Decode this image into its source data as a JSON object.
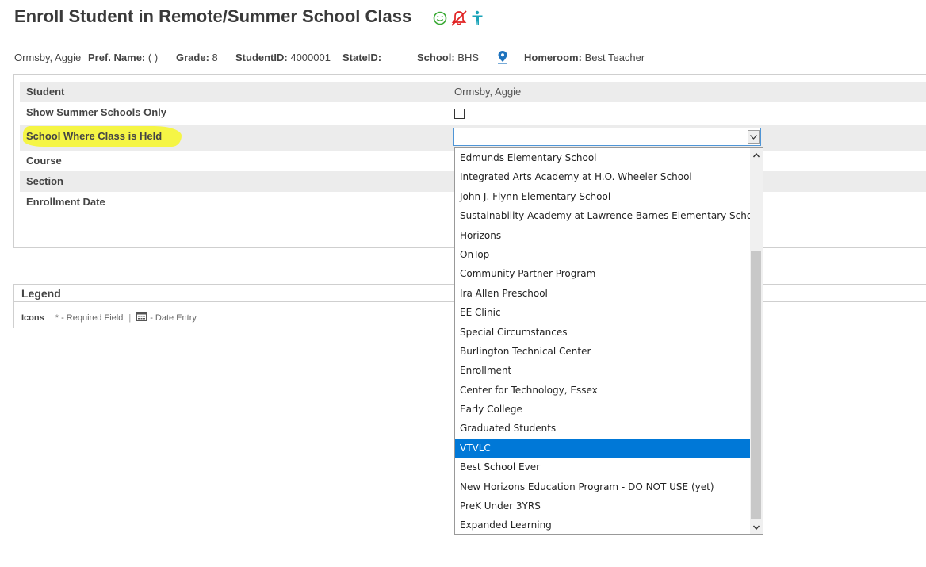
{
  "page": {
    "title": "Enroll Student in Remote/Summer School Class",
    "icons": [
      "smiley-icon",
      "alert-bell-off-icon",
      "accessibility-icon"
    ]
  },
  "student_bar": {
    "name": "Ormsby, Aggie",
    "pref_name_label": "Pref. Name:",
    "pref_name_value": "( )",
    "grade_label": "Grade:",
    "grade_value": "8",
    "student_id_label": "StudentID:",
    "student_id_value": "4000001",
    "state_id_label": "StateID:",
    "state_id_value": "",
    "school_label": "School:",
    "school_value": "BHS",
    "homeroom_label": "Homeroom:",
    "homeroom_value": "Best Teacher"
  },
  "form": {
    "student_label": "Student",
    "student_value": "Ormsby, Aggie",
    "summer_only_label": "Show Summer Schools Only",
    "summer_only_checked": false,
    "school_label": "School Where Class is Held",
    "school_value": "",
    "course_label": "Course",
    "section_label": "Section",
    "enrollment_date_label": "Enrollment Date"
  },
  "dropdown": {
    "options": [
      "Edmunds Elementary School",
      "Integrated Arts Academy at H.O. Wheeler School",
      "John J. Flynn Elementary School",
      "Sustainability Academy at Lawrence Barnes Elementary School",
      "Horizons",
      "OnTop",
      "Community Partner Program",
      "Ira Allen Preschool",
      "EE Clinic",
      "Special Circumstances",
      "Burlington Technical Center",
      "Enrollment",
      "Center for Technology, Essex",
      "Early College",
      "Graduated Students",
      "VTVLC",
      "Best School Ever",
      "New Horizons Education Program - DO NOT USE (yet)",
      "PreK Under 3YRS",
      "Expanded Learning"
    ],
    "highlighted_index": 15
  },
  "legend": {
    "title": "Legend",
    "icons_label": "Icons",
    "required_text": "* - Required Field",
    "separator": "|",
    "date_entry_text": "- Date Entry"
  },
  "colors": {
    "highlight": "#f5f53c",
    "selected_option": "#0078d7",
    "row_shade": "#ececec",
    "smiley": "#3aaa35",
    "alert": "#e02020",
    "accessibility": "#1aa3b8",
    "location_pin": "#1e73be"
  }
}
